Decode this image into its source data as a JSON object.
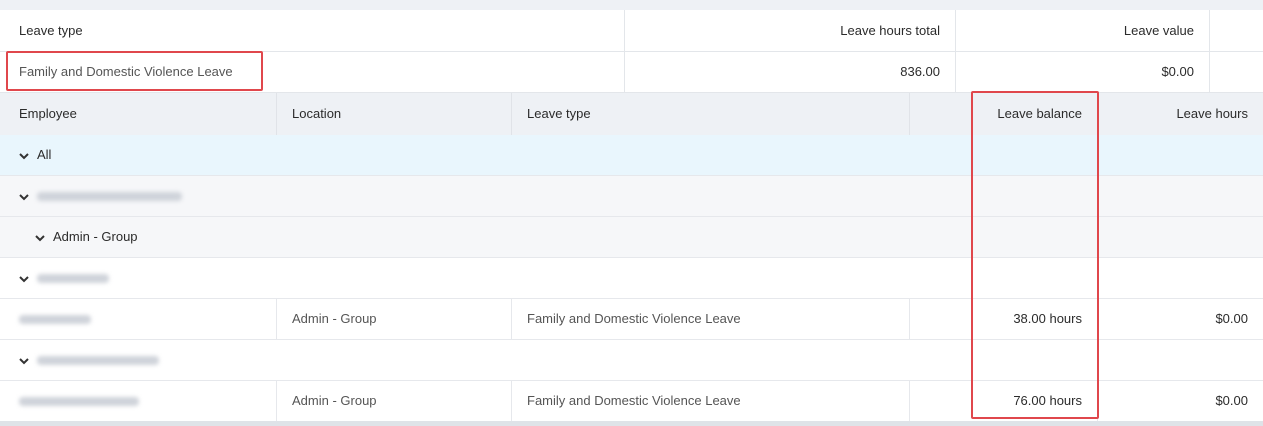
{
  "summary": {
    "headers": {
      "leave_type": "Leave type",
      "leave_hours_total": "Leave hours total",
      "leave_value": "Leave value"
    },
    "row": {
      "leave_type": "Family and Domestic Violence Leave",
      "leave_hours_total": "836.00",
      "leave_value": "$0.00"
    }
  },
  "details": {
    "headers": {
      "employee": "Employee",
      "location": "Location",
      "leave_type": "Leave type",
      "leave_balance": "Leave balance",
      "leave_hours": "Leave hours"
    },
    "group_all": "All",
    "group_location": "Admin - Group",
    "rows": [
      {
        "location": "Admin - Group",
        "leave_type": "Family and Domestic Violence Leave",
        "leave_balance": "38.00 hours",
        "leave_hours": "$0.00"
      },
      {
        "location": "Admin - Group",
        "leave_type": "Family and Domestic Violence Leave",
        "leave_balance": "76.00 hours",
        "leave_hours": "$0.00"
      }
    ]
  },
  "colors": {
    "highlight": "#e0474c",
    "all_row_bg": "#e9f6fd",
    "header_bg": "#eef1f5",
    "group_row_bg": "#f6f7f9"
  },
  "icons": {
    "expander": "chevron-down-icon"
  }
}
